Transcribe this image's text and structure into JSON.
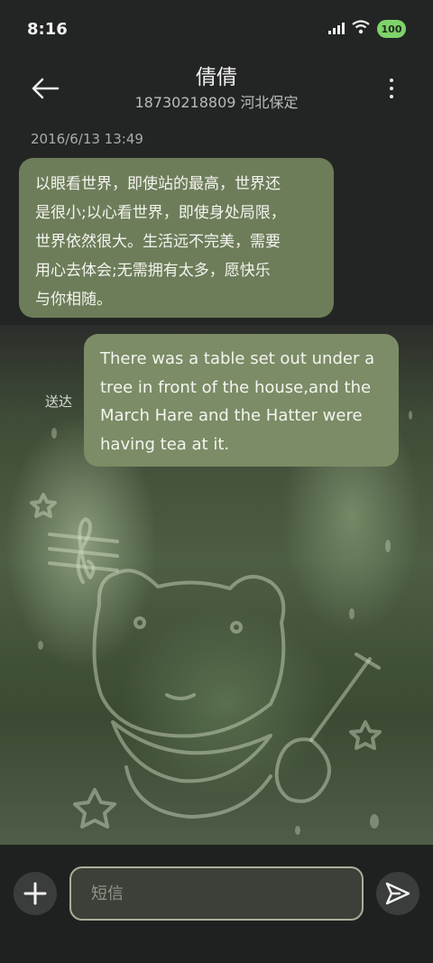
{
  "status_bar": {
    "time": "8:16",
    "battery": "100"
  },
  "header": {
    "contact_name": "倩倩",
    "contact_sub": "18730218809 河北保定"
  },
  "conversation": {
    "date": "2016/6/13 13:49",
    "incoming_lines": [
      "以眼看世界，即使站的最高，世界还",
      "是很小;以心看世界，即使身处局限，",
      "世界依然很大。生活远不完美，需要",
      "用心去体会;无需拥有太多，愿快乐",
      "与你相随。"
    ],
    "outgoing_lines": [
      "There was a table set out under a",
      "tree in front of the house,and the",
      "March Hare and the Hatter were",
      "having tea at it."
    ],
    "sent_status": "送达"
  },
  "composer": {
    "placeholder": "短信"
  },
  "icons": {
    "back": "arrow-left-icon",
    "more": "more-vertical-icon",
    "add": "plus-icon",
    "send": "send-icon",
    "signal": "signal-icon",
    "wifi": "wifi-icon"
  },
  "colors": {
    "bubble_incoming": "#6d7d5a",
    "bubble_outgoing": "#7b8c66",
    "battery": "#7fd36b",
    "background": "#232524"
  }
}
